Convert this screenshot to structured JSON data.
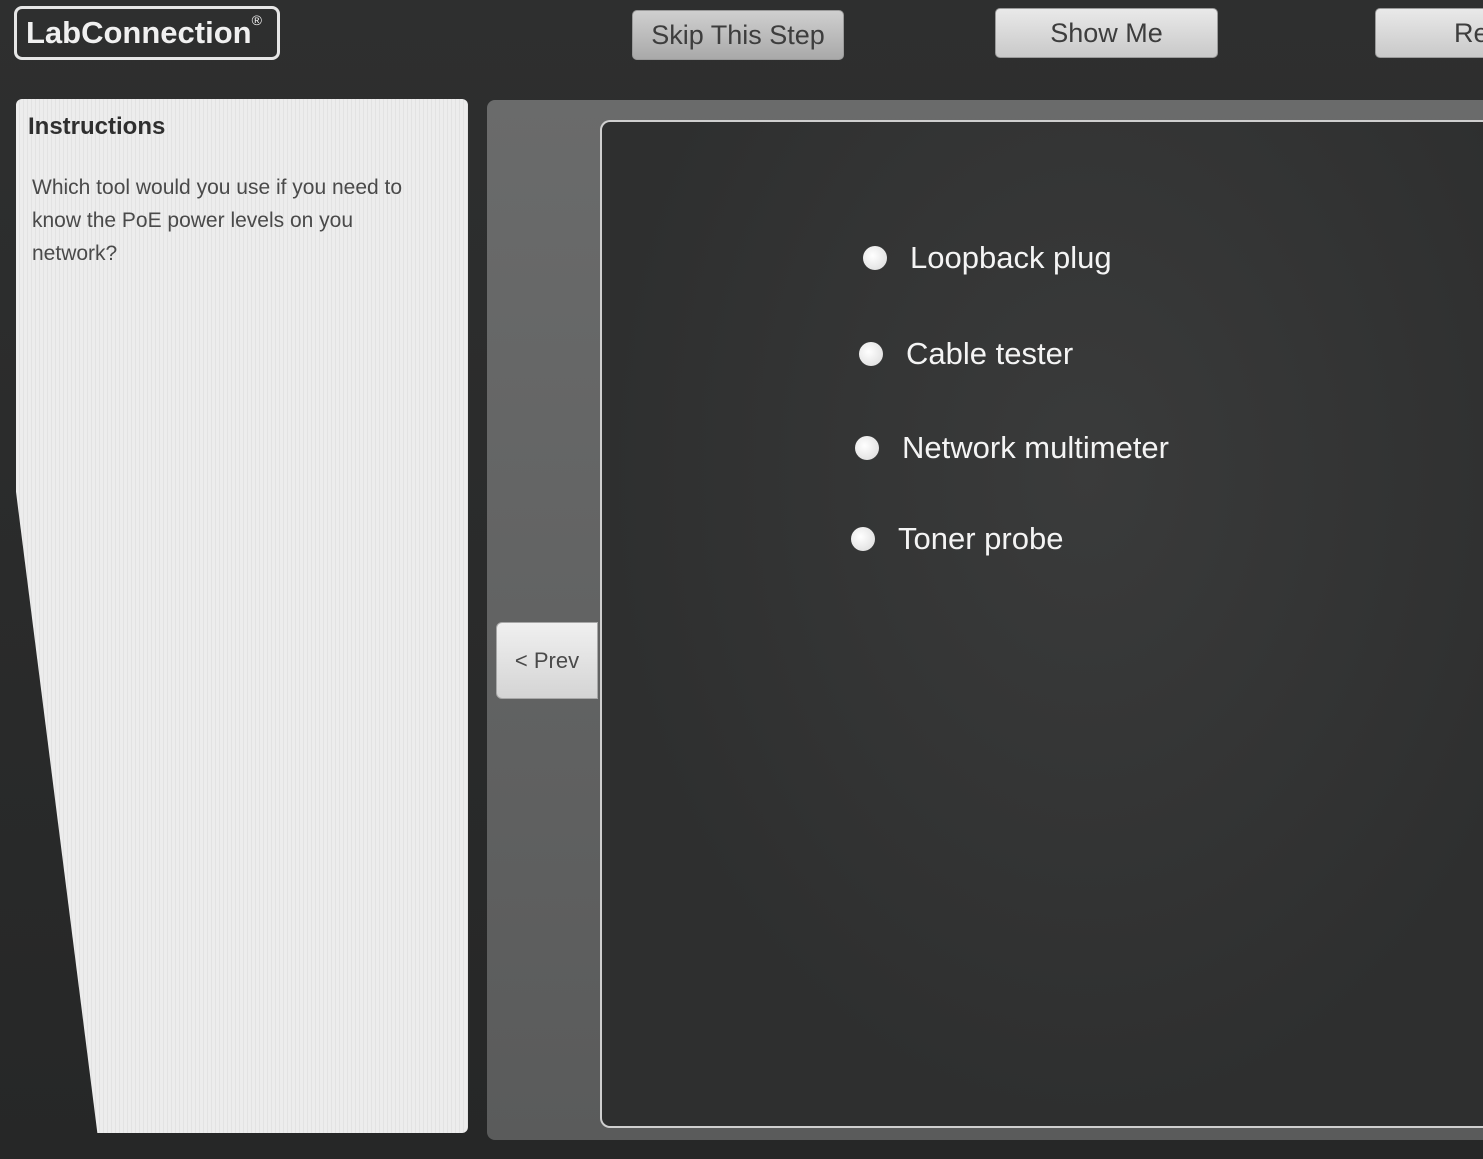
{
  "header": {
    "logo_text": "LabConnection",
    "logo_mark": "®",
    "skip_label": "Skip This Step",
    "show_me_label": "Show Me",
    "reset_label_partial": "Re"
  },
  "instructions": {
    "title": "Instructions",
    "text": "Which tool would you use if you need to know the PoE power levels on you network?"
  },
  "navigation": {
    "prev_label": "< Prev"
  },
  "question": {
    "options": [
      {
        "label": "Loopback plug"
      },
      {
        "label": "Cable tester"
      },
      {
        "label": "Network multimeter"
      },
      {
        "label": "Toner probe"
      }
    ]
  },
  "colors": {
    "background": "#2a2b2b",
    "answer_panel": "#323333",
    "instructions_panel": "#ececec",
    "button_face": "#d9d9d9"
  }
}
